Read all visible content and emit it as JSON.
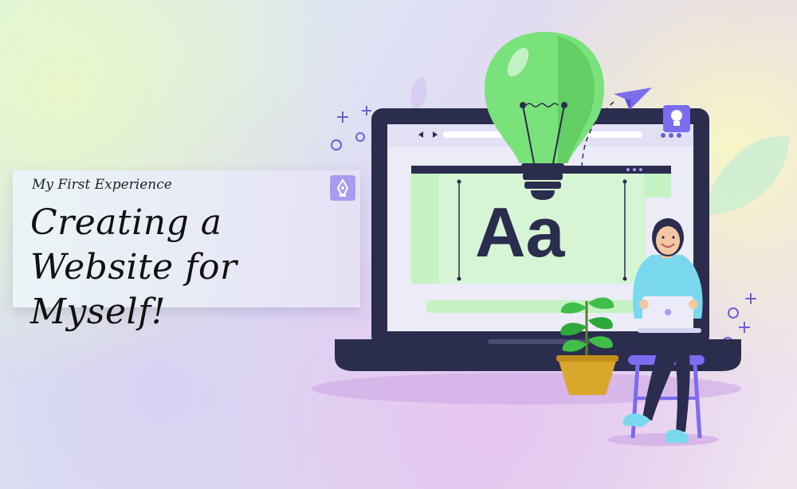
{
  "banner": {
    "subtitle": "My First Experience",
    "title": "Creating a Website for Myself!"
  },
  "illustration": {
    "glyph_sample": "Aa"
  },
  "colors": {
    "laptop": "#2b2d4e",
    "screen": "#ecebf8",
    "bulb": "#79e27a",
    "panel_green": "#c4f2c2",
    "accent_purple": "#7b6cf0",
    "pot": "#d9a72b",
    "shirt": "#7ad8ee"
  },
  "icons": [
    "pen-tool-icon",
    "lightbulb-icon",
    "paper-plane-icon",
    "plant-icon"
  ]
}
